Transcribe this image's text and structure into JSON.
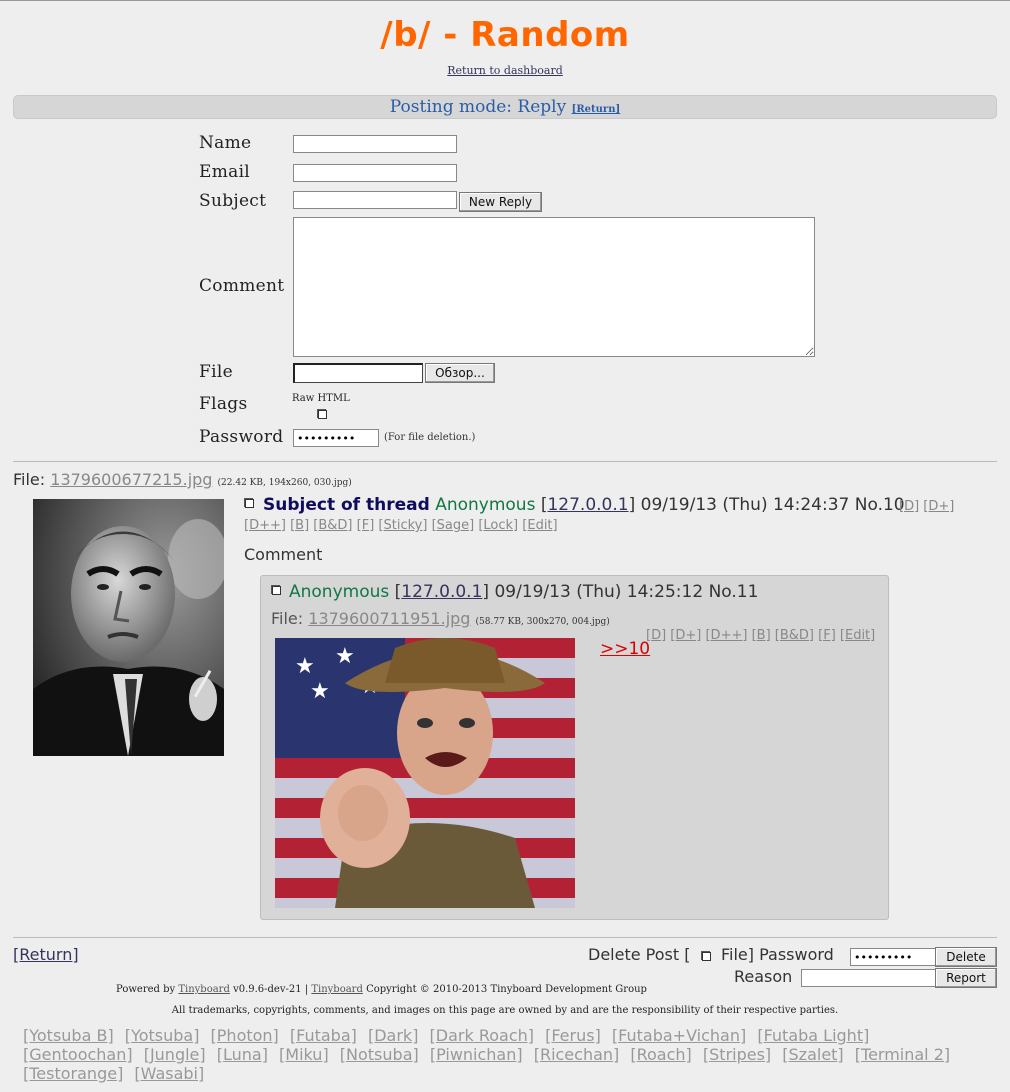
{
  "header": {
    "title": "/b/ - Random",
    "dashboard_link": "Return to dashboard"
  },
  "posting_mode": {
    "label": "Posting mode: Reply",
    "return_link": "[Return]"
  },
  "form": {
    "name_label": "Name",
    "email_label": "Email",
    "subject_label": "Subject",
    "comment_label": "Comment",
    "file_label": "File",
    "flags_label": "Flags",
    "password_label": "Password",
    "name_value": "",
    "email_value": "",
    "subject_value": "",
    "comment_value": "",
    "submit_button": "New Reply",
    "browse_button": "Обзор...",
    "raw_html_label": "Raw HTML",
    "password_value": "•••••••••",
    "password_note": "(For file deletion.)"
  },
  "op": {
    "file_prefix": "File:",
    "file_name": "1379600677215.jpg",
    "file_info": "(22.42 KB, 194x260, 030.jpg)",
    "subject": "Subject of thread",
    "name": "Anonymous",
    "ip": "127.0.0.1",
    "datetime": "09/19/13 (Thu) 14:24:37",
    "number": "No.10",
    "controls_line1": [
      "[D]",
      "[D+]"
    ],
    "controls_line2": [
      "[D++]",
      "[B]",
      "[B&D]",
      "[F]",
      "[Sticky]",
      "[Sage]",
      "[Lock]",
      "[Edit]"
    ],
    "body": "Comment"
  },
  "reply": {
    "name": "Anonymous",
    "ip": "127.0.0.1",
    "datetime": "09/19/13 (Thu) 14:25:12",
    "number": "No.11",
    "file_prefix": "File:",
    "file_name": "1379600711951.jpg",
    "file_info": "(58.77 KB, 300x270, 004.jpg)",
    "controls": [
      "[D]",
      "[D+]",
      "[D++]",
      "[B]",
      "[B&D]",
      "[F]",
      "[Edit]"
    ],
    "quote": ">>10"
  },
  "footer": {
    "return_link": "[Return]",
    "delete_post_label": "Delete Post [",
    "file_label": "File] Password",
    "password_value": "•••••••••",
    "delete_button": "Delete",
    "reason_label": "Reason",
    "reason_value": "",
    "report_button": "Report",
    "powered_prefix": "Powered by",
    "tinyboard_link": "Tinyboard",
    "version": "v0.9.6-dev-21 |",
    "tinyboard_link2": "Tinyboard",
    "copyright": "Copyright © 2010-2013 Tinyboard Development Group",
    "trademarks": "All trademarks, copyrights, comments, and images on this page are owned by and are the responsibility of their respective parties."
  },
  "styles": [
    "[Yotsuba B]",
    "[Yotsuba]",
    "[Photon]",
    "[Futaba]",
    "[Dark]",
    "[Dark Roach]",
    "[Ferus]",
    "[Futaba+Vichan]",
    "[Futaba Light]",
    "[Gentoochan]",
    "[Jungle]",
    "[Luna]",
    "[Miku]",
    "[Notsuba]",
    "[Piwnichan]",
    "[Ricechan]",
    "[Roach]",
    "[Stripes]",
    "[Szalet]",
    "[Terminal 2]",
    "[Testorange]",
    "[Wasabi]"
  ],
  "colors": {
    "title": "#ff6600",
    "posting_bar_text": "#2b5da6",
    "name_green": "#117743",
    "subject_navy": "#0f0c5d",
    "quote_red": "#dd0000"
  }
}
